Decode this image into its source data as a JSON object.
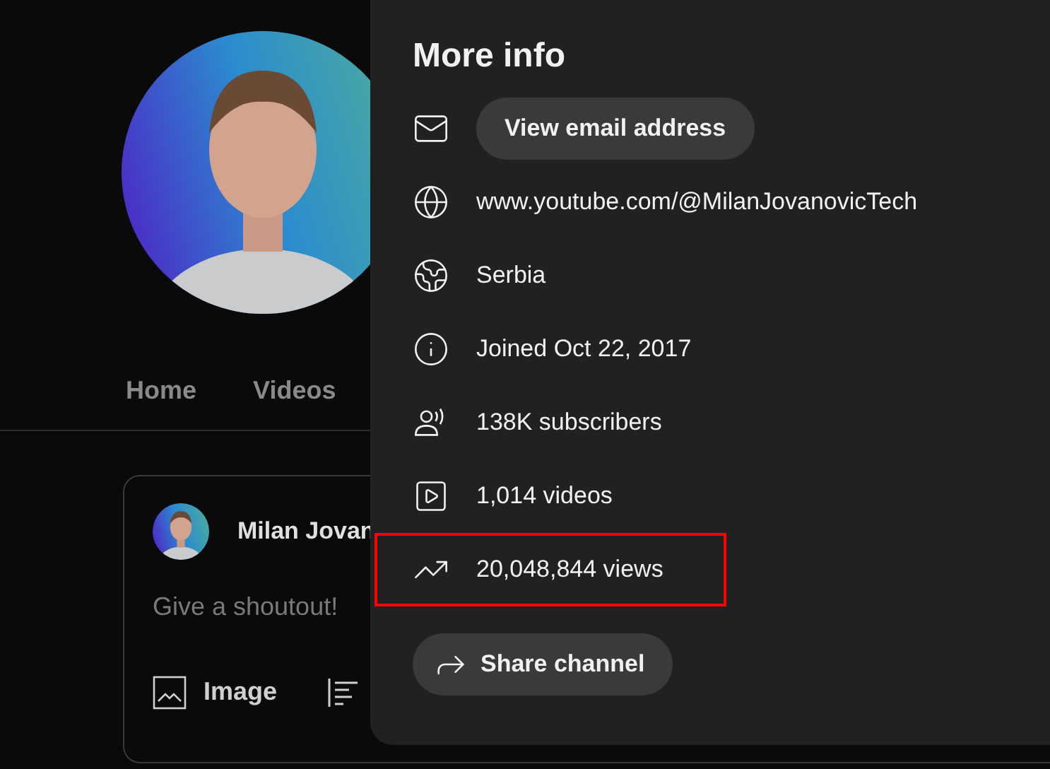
{
  "channel_page": {
    "tabs": [
      {
        "label": "Home",
        "selected": false
      },
      {
        "label": "Videos",
        "selected": false
      }
    ],
    "post_card": {
      "author": "Milan Jovan",
      "placeholder": "Give a shoutout!",
      "actions": [
        {
          "kind": "image",
          "label": "Image"
        },
        {
          "kind": "poll"
        }
      ]
    }
  },
  "dialog": {
    "title": "More info",
    "items": [
      {
        "kind": "email",
        "text": "View email address",
        "highlighted": false
      },
      {
        "kind": "link",
        "text": "www.youtube.com/@MilanJovanovicTech",
        "highlighted": false
      },
      {
        "kind": "location",
        "text": "Serbia",
        "highlighted": false
      },
      {
        "kind": "joined",
        "text": "Joined Oct 22, 2017",
        "highlighted": false
      },
      {
        "kind": "subscribers",
        "text": "138K subscribers",
        "highlighted": false
      },
      {
        "kind": "videos",
        "text": "1,014 videos",
        "highlighted": false
      },
      {
        "kind": "views",
        "text": "20,048,844 views",
        "highlighted": true
      }
    ],
    "share_button": "Share channel"
  }
}
